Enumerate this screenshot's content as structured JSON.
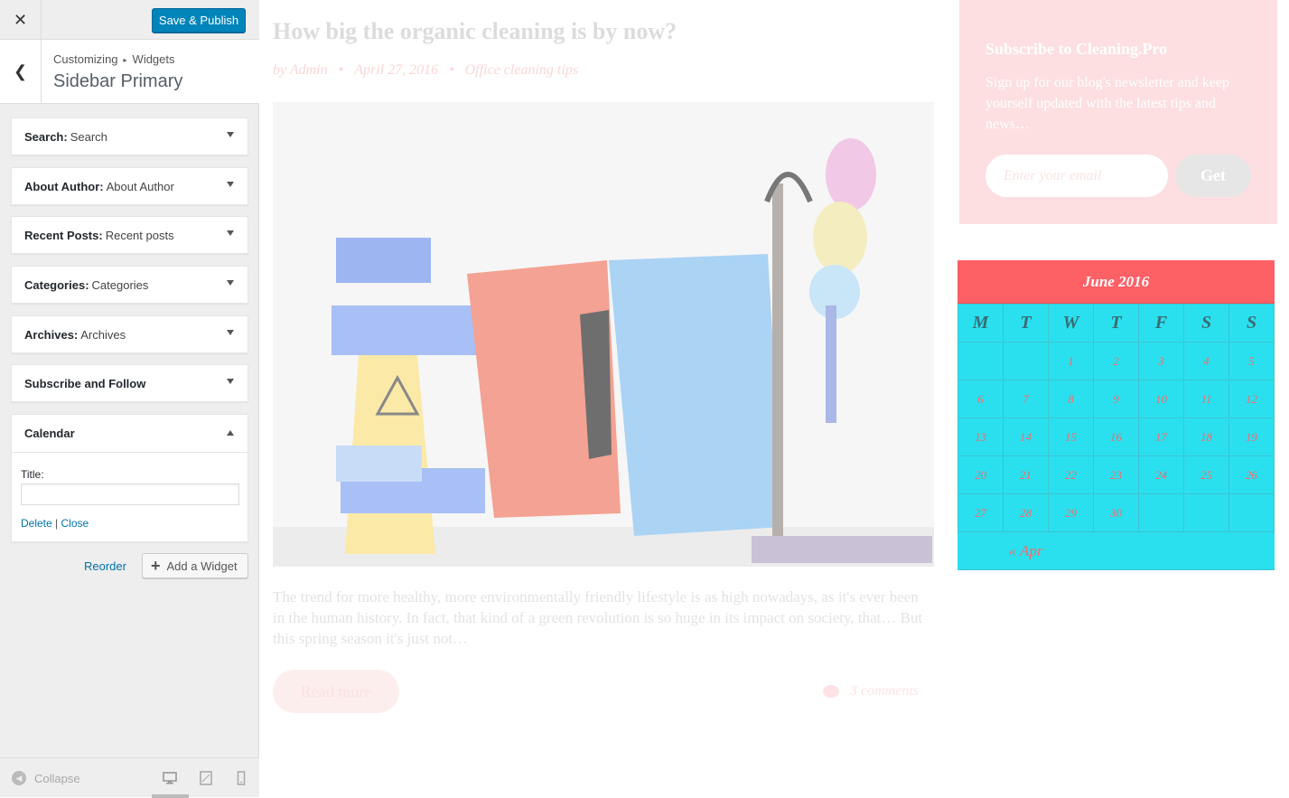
{
  "customizer": {
    "publish_label": "Save & Publish",
    "close_glyph": "✕",
    "back_glyph": "❮",
    "breadcrumb": [
      "Customizing",
      "Widgets"
    ],
    "breadcrumb_sep": "▸",
    "section_title": "Sidebar Primary",
    "widgets": [
      {
        "type": "Search:",
        "name": "Search"
      },
      {
        "type": "About Author:",
        "name": "About Author"
      },
      {
        "type": "Recent Posts:",
        "name": "Recent posts"
      },
      {
        "type": "Categories:",
        "name": "Categories"
      },
      {
        "type": "Archives:",
        "name": "Archives"
      },
      {
        "type": "Subscribe and Follow",
        "name": ""
      }
    ],
    "open_widget": {
      "title": "Calendar",
      "field_label": "Title:",
      "field_value": "",
      "delete_label": "Delete",
      "separator": "|",
      "close_label": "Close"
    },
    "reorder_label": "Reorder",
    "add_widget_label": "Add a Widget",
    "collapse_label": "Collapse",
    "devices": [
      "desktop-icon",
      "tablet-icon",
      "mobile-icon"
    ]
  },
  "post": {
    "title": "How big the organic cleaning is by now?",
    "author": "by Admin",
    "date": "April 27, 2016",
    "category": "Office cleaning tips",
    "excerpt": "The trend for more healthy, more environmentally friendly lifestyle is as high nowadays, as it's ever been in the human history. In fact, that kind of a green revolution is so huge in its impact on society, that… But this spring season it's just not…",
    "read_more": "Read more",
    "comments": "3 comments"
  },
  "subscribe": {
    "title": "Subscribe to Cleaning.Pro",
    "text": "Sign up for our blog's newsletter and keep yourself updated with the latest tips and news…",
    "placeholder": "Enter your email",
    "button": "Get"
  },
  "calendar": {
    "caption": "June 2016",
    "days": [
      "M",
      "T",
      "W",
      "T",
      "F",
      "S",
      "S"
    ],
    "weeks": [
      [
        "",
        "",
        "1",
        "2",
        "3",
        "4",
        "5"
      ],
      [
        "6",
        "7",
        "8",
        "9",
        "10",
        "11",
        "12"
      ],
      [
        "13",
        "14",
        "15",
        "16",
        "17",
        "18",
        "19"
      ],
      [
        "20",
        "21",
        "22",
        "23",
        "24",
        "25",
        "26"
      ],
      [
        "27",
        "28",
        "29",
        "30",
        "",
        "",
        ""
      ]
    ],
    "prev_link": "« Apr"
  },
  "colors": {
    "publish": "#0085ba",
    "calendar_header": "#fd6065",
    "calendar_body": "#2ae0ef",
    "subscribe_bg": "#fddfe1"
  }
}
